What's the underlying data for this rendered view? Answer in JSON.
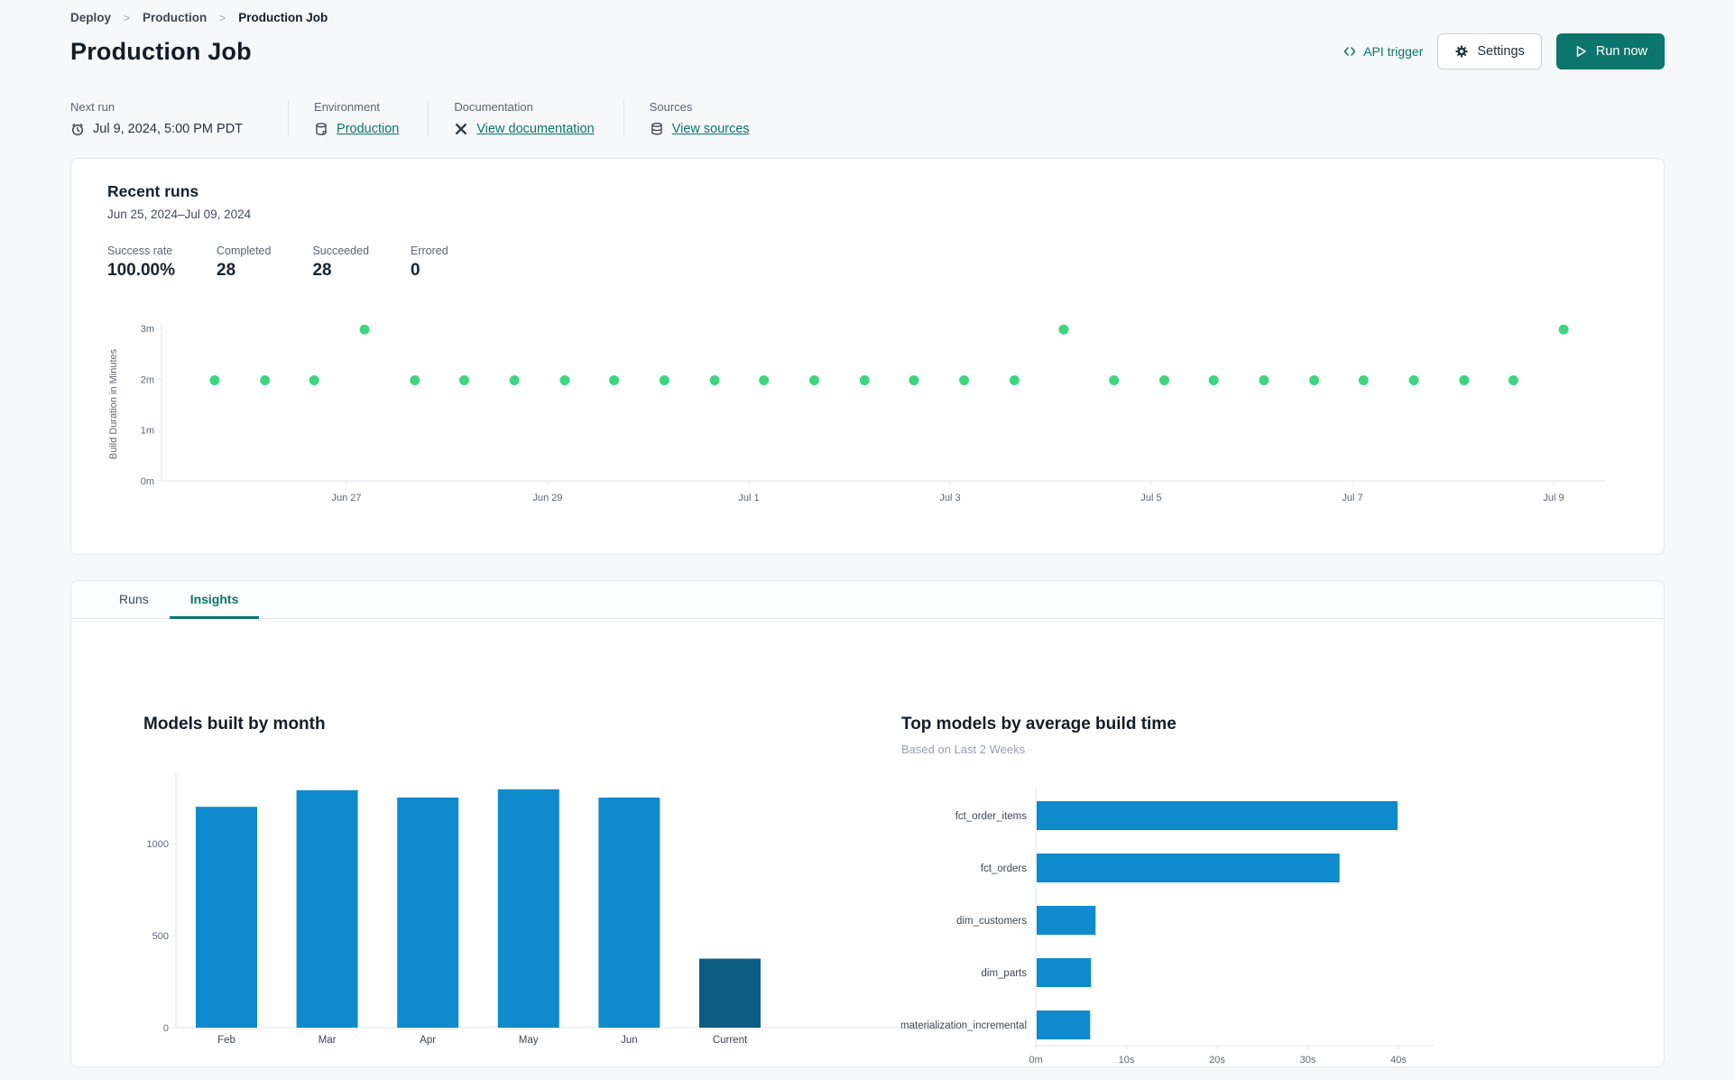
{
  "breadcrumb": {
    "items": [
      "Deploy",
      "Production",
      "Production Job"
    ],
    "separator": ">"
  },
  "page_title": "Production Job",
  "header_actions": {
    "api_trigger_label": "API trigger",
    "api_trigger_icon": "code-icon",
    "settings_label": "Settings",
    "settings_icon": "gear-icon",
    "run_now_label": "Run now",
    "run_now_icon": "play-icon"
  },
  "meta": [
    {
      "label": "Next run",
      "value": "Jul 9, 2024, 5:00 PM PDT",
      "icon": "clock-icon",
      "is_link": false
    },
    {
      "label": "Environment",
      "value": "Production",
      "icon": "environment-database-icon",
      "is_link": true
    },
    {
      "label": "Documentation",
      "value": "View documentation",
      "icon": "dbt-docs-icon",
      "is_link": true
    },
    {
      "label": "Sources",
      "value": "View sources",
      "icon": "sources-database-icon",
      "is_link": true
    }
  ],
  "recent_runs": {
    "title": "Recent runs",
    "date_range": "Jun 25, 2024–Jul 09, 2024",
    "stats": [
      {
        "label": "Success rate",
        "value": "100.00%"
      },
      {
        "label": "Completed",
        "value": "28"
      },
      {
        "label": "Succeeded",
        "value": "28"
      },
      {
        "label": "Errored",
        "value": "0"
      }
    ]
  },
  "tabs": [
    {
      "label": "Runs",
      "active": false
    },
    {
      "label": "Insights",
      "active": true
    }
  ],
  "colors": {
    "accent_teal": "#0c756d",
    "bar_blue": "#0e8acd",
    "bar_dark": "#0d5c82",
    "dot_green": "#3ed57e",
    "axis_gray": "#e3e6ea"
  },
  "chart_data": [
    {
      "id": "build_duration",
      "type": "scatter",
      "ylabel": "Build Duration in Minutes",
      "yticks": [
        {
          "v": 0,
          "label": "0m"
        },
        {
          "v": 1,
          "label": "1m"
        },
        {
          "v": 2,
          "label": "2m"
        },
        {
          "v": 3,
          "label": "3m"
        }
      ],
      "xticks": [
        {
          "v": 2,
          "label": "Jun 27"
        },
        {
          "v": 4,
          "label": "Jun 29"
        },
        {
          "v": 6,
          "label": "Jul 1"
        },
        {
          "v": 8,
          "label": "Jul 3"
        },
        {
          "v": 10,
          "label": "Jul 5"
        },
        {
          "v": 12,
          "label": "Jul 7"
        },
        {
          "v": 14,
          "label": "Jul 9"
        }
      ],
      "x_unit": "days since Jun 25, 2024",
      "ylim": [
        0,
        3.3
      ],
      "xlim": [
        0,
        14.6
      ],
      "grid": false,
      "point_color": "#3ed57e",
      "points_x": [
        0.69,
        1.19,
        1.68,
        2.18,
        2.68,
        3.17,
        3.67,
        4.17,
        4.66,
        5.16,
        5.66,
        6.15,
        6.65,
        7.15,
        7.64,
        8.14,
        8.64,
        9.13,
        9.63,
        10.13,
        10.62,
        11.12,
        11.62,
        12.11,
        12.61,
        13.11,
        13.6,
        14.1
      ],
      "points_y": [
        1.98,
        1.98,
        1.98,
        2.98,
        1.98,
        1.98,
        1.98,
        1.98,
        1.98,
        1.98,
        1.98,
        1.98,
        1.98,
        1.98,
        1.98,
        1.98,
        1.98,
        2.98,
        1.98,
        1.98,
        1.98,
        1.98,
        1.98,
        1.98,
        1.98,
        1.98,
        1.98,
        2.98
      ]
    },
    {
      "id": "models_by_month",
      "type": "bar",
      "title": "Models built by month",
      "categories": [
        "Feb",
        "Mar",
        "Apr",
        "May",
        "Jun",
        "Current"
      ],
      "values": [
        1200,
        1290,
        1250,
        1295,
        1250,
        375
      ],
      "bar_colors": [
        "#0e8acd",
        "#0e8acd",
        "#0e8acd",
        "#0e8acd",
        "#0e8acd",
        "#0d5c82"
      ],
      "yticks": [
        0,
        500,
        1000
      ],
      "ylim": [
        0,
        1390
      ],
      "grid": false,
      "xlabel": "",
      "ylabel": ""
    },
    {
      "id": "top_models",
      "type": "hbar",
      "title": "Top models by average build time",
      "subtitle": "Based on Last 2 Weeks",
      "categories": [
        "fct_order_items",
        "fct_orders",
        "dim_customers",
        "dim_parts",
        "materialization_incremental"
      ],
      "values": [
        39.8,
        33.4,
        6.5,
        6.0,
        5.9
      ],
      "value_unit": "seconds",
      "xticks": [
        {
          "v": 0,
          "label": "0m"
        },
        {
          "v": 10,
          "label": "10s"
        },
        {
          "v": 20,
          "label": "20s"
        },
        {
          "v": 30,
          "label": "30s"
        },
        {
          "v": 40,
          "label": "40s"
        }
      ],
      "xlim": [
        0,
        44
      ],
      "grid": false,
      "bar_color": "#0e8acd"
    }
  ]
}
